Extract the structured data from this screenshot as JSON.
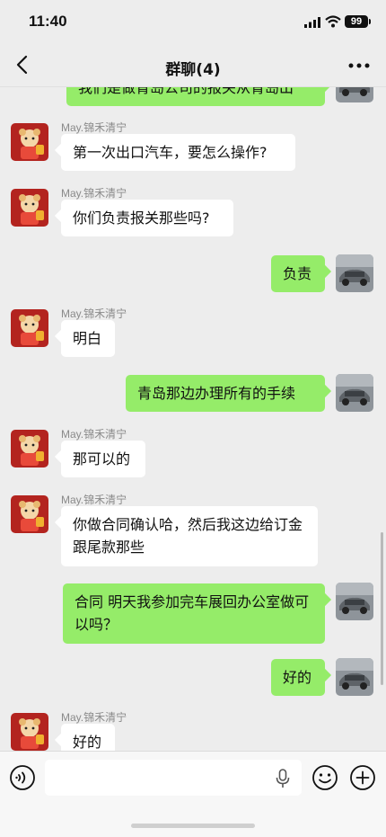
{
  "status_bar": {
    "time": "11:40",
    "battery": "99"
  },
  "nav": {
    "title": "群聊(4)"
  },
  "sender_name": "May.锦禾清宁",
  "messages": [
    {
      "side": "right",
      "text": "我们是做青岛公司的报关从青岛出"
    },
    {
      "side": "left",
      "text": "第一次出口汽车，要怎么操作?"
    },
    {
      "side": "left",
      "text": "你们负责报关那些吗?"
    },
    {
      "side": "right",
      "text": "负责"
    },
    {
      "side": "left",
      "text": "明白"
    },
    {
      "side": "right",
      "text": "青岛那边办理所有的手续"
    },
    {
      "side": "left",
      "text": "那可以的"
    },
    {
      "side": "left",
      "text": "你做合同确认哈，然后我这边给订金跟尾款那些"
    },
    {
      "side": "right",
      "text": "合同 明天我参加完车展回办公室做可以吗？"
    },
    {
      "side": "right",
      "text": "好的"
    },
    {
      "side": "left",
      "text": "好的"
    }
  ],
  "input": {
    "value": "",
    "placeholder": ""
  },
  "icons": {
    "back": "chevron-left-icon",
    "more": "more-icon",
    "voice": "voice-icon",
    "mic": "mic-icon",
    "emoji": "emoji-icon",
    "plus": "plus-icon"
  },
  "colors": {
    "background": "#ededed",
    "bubble_self": "#95ec69",
    "bubble_other": "#ffffff",
    "sender_name": "#8a8a8a"
  }
}
